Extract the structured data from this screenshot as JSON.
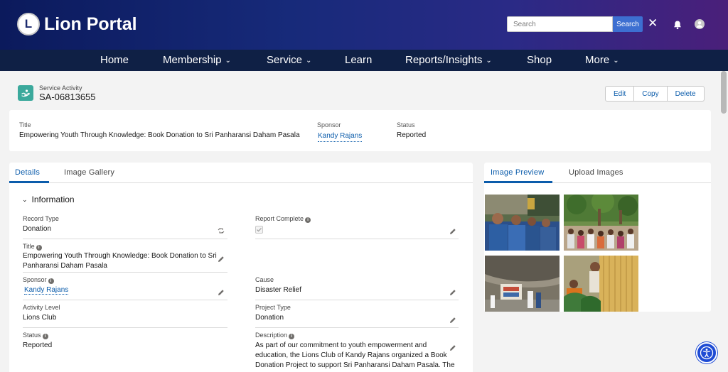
{
  "brand": {
    "name": "Lion Portal",
    "logo_text": "L"
  },
  "search": {
    "placeholder": "Search",
    "button": "Search"
  },
  "nav": [
    {
      "label": "Home",
      "has_dropdown": false
    },
    {
      "label": "Membership",
      "has_dropdown": true
    },
    {
      "label": "Service",
      "has_dropdown": true
    },
    {
      "label": "Learn",
      "has_dropdown": false
    },
    {
      "label": "Reports/Insights",
      "has_dropdown": true
    },
    {
      "label": "Shop",
      "has_dropdown": false
    },
    {
      "label": "More",
      "has_dropdown": true
    }
  ],
  "record": {
    "type": "Service Activity",
    "id": "SA-06813655",
    "actions": {
      "edit": "Edit",
      "copy": "Copy",
      "delete": "Delete"
    }
  },
  "highlights": {
    "title_label": "Title",
    "title": "Empowering Youth Through Knowledge: Book Donation to Sri Panharansi Daham Pasala",
    "sponsor_label": "Sponsor",
    "sponsor": "Kandy Rajans",
    "status_label": "Status",
    "status": "Reported"
  },
  "left_tabs": {
    "details": "Details",
    "gallery": "Image Gallery"
  },
  "section": {
    "title": "Information"
  },
  "fields": {
    "record_type": {
      "label": "Record Type",
      "value": "Donation"
    },
    "report_complete": {
      "label": "Report Complete",
      "checked": true
    },
    "title": {
      "label": "Title",
      "value_line1": "Empowering Youth Through Knowledge: Book Donation to Sri",
      "value_line2": "Panharansi Daham Pasala"
    },
    "sponsor": {
      "label": "Sponsor",
      "value": "Kandy Rajans"
    },
    "cause": {
      "label": "Cause",
      "value": "Disaster Relief"
    },
    "activity_level": {
      "label": "Activity Level",
      "value": "Lions Club"
    },
    "project_type": {
      "label": "Project Type",
      "value": "Donation"
    },
    "status": {
      "label": "Status",
      "value": "Reported"
    },
    "description": {
      "label": "Description",
      "line1": "As part of our commitment to youth empowerment and",
      "line2": "education, the Lions Club of Kandy Rajans organized a Book",
      "line3": "Donation Project to support Sri Panharansi Daham Pasala. The"
    }
  },
  "right_tabs": {
    "preview": "Image Preview",
    "upload": "Upload Images"
  },
  "colors": {
    "accent": "#0b5cab",
    "header_dark": "#0f2045",
    "record_icon": "#3ba99c",
    "a11y": "#1e4bd4"
  }
}
